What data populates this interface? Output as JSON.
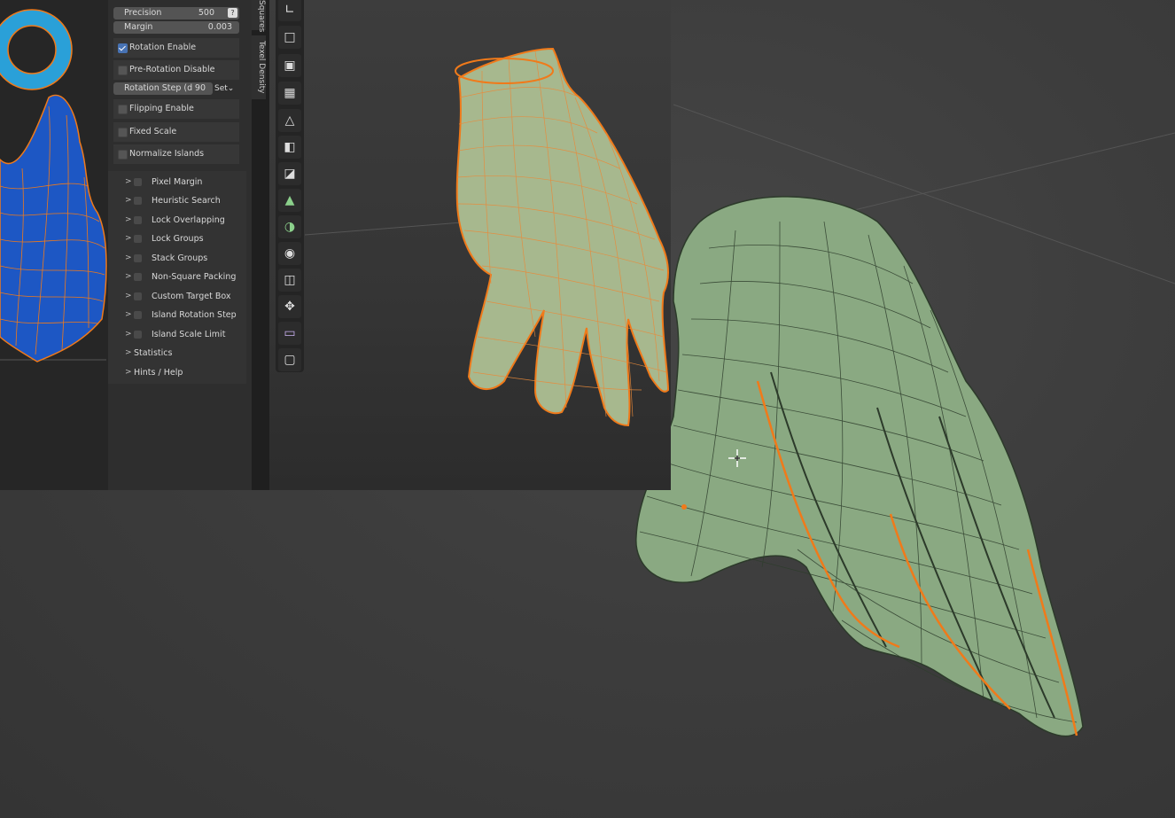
{
  "npanel": {
    "precision": {
      "label": "Precision",
      "value": "500"
    },
    "margin": {
      "label": "Margin",
      "value": "0.003"
    },
    "rotation_enable": {
      "label": "Rotation Enable",
      "checked": true
    },
    "pre_rotation_disable": {
      "label": "Pre-Rotation Disable",
      "checked": false
    },
    "rotation_step": {
      "label": "Rotation Step (d",
      "value": "90",
      "set_label": "Set"
    },
    "flipping_enable": {
      "label": "Flipping Enable",
      "checked": false
    },
    "fixed_scale": {
      "label": "Fixed Scale",
      "checked": false
    },
    "normalize_islands": {
      "label": "Normalize Islands",
      "checked": false
    },
    "subpanels": [
      {
        "label": "Pixel Margin"
      },
      {
        "label": "Heuristic Search"
      },
      {
        "label": "Lock Overlapping"
      },
      {
        "label": "Lock Groups"
      },
      {
        "label": "Stack Groups"
      },
      {
        "label": "Non-Square Packing"
      },
      {
        "label": "Custom Target Box"
      },
      {
        "label": "Island Rotation Step"
      },
      {
        "label": "Island Scale Limit"
      }
    ],
    "plain_panels": [
      {
        "label": "Statistics"
      },
      {
        "label": "Hints / Help"
      }
    ]
  },
  "vertical_tabs": [
    {
      "label": "Squares"
    },
    {
      "label": "Texel Density"
    }
  ],
  "toolbar_icons": [
    "measure-icon",
    "add-cube-icon",
    "extrude-icon",
    "inset-icon",
    "bevel-icon",
    "loop-cut-icon",
    "knife-icon",
    "poly-build-icon",
    "spin-icon",
    "smooth-icon",
    "edge-slide-icon",
    "shrink-fatten-icon",
    "shear-icon",
    "rip-icon"
  ],
  "colors": {
    "mesh_green": "#8aa982",
    "seam_orange": "#f07a1a",
    "uv_blue": "#1f6fd0"
  }
}
